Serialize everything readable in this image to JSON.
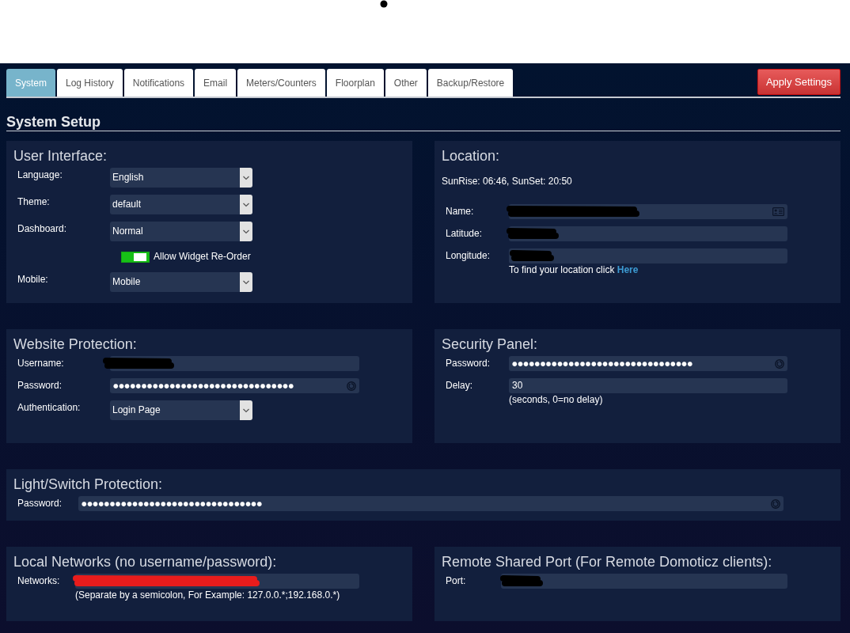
{
  "tabs": [
    {
      "label": "System",
      "selected": true
    },
    {
      "label": "Log History",
      "selected": false
    },
    {
      "label": "Notifications",
      "selected": false
    },
    {
      "label": "Email",
      "selected": false
    },
    {
      "label": "Meters/Counters",
      "selected": false
    },
    {
      "label": "Floorplan",
      "selected": false
    },
    {
      "label": "Other",
      "selected": false
    },
    {
      "label": "Backup/Restore",
      "selected": false
    }
  ],
  "apply_button": "Apply Settings",
  "heading": "System Setup",
  "rows": [
    [
      {
        "title": "User Interface:",
        "items": [
          {
            "kind": "select",
            "label": "Language:",
            "value": "English"
          },
          {
            "kind": "select",
            "label": "Theme:",
            "value": "default"
          },
          {
            "kind": "select",
            "label": "Dashboard:",
            "value": "Normal"
          },
          {
            "kind": "toggle",
            "label": "Allow Widget Re-Order",
            "on": true
          },
          {
            "kind": "select",
            "label": "Mobile:",
            "value": "Mobile"
          }
        ]
      },
      {
        "title": "Location:",
        "items": [
          {
            "kind": "info",
            "text": "SunRise: 06:46, SunSet: 20:50"
          },
          {
            "kind": "input",
            "label": "Name:",
            "autofill": true,
            "redaction": {
              "color": "#000000"
            }
          },
          {
            "kind": "input",
            "label": "Latitude:",
            "redaction": {
              "color": "#000000"
            }
          },
          {
            "kind": "input",
            "label": "Longitude:",
            "redaction": {
              "color": "#000000"
            },
            "note": "To find your location click",
            "note_link": "Here"
          }
        ]
      }
    ],
    [
      {
        "title": "Website Protection:",
        "items": [
          {
            "kind": "input",
            "label": "Username:",
            "redaction": {
              "color": "#000000"
            }
          },
          {
            "kind": "password",
            "label": "Password:",
            "value": "●●●●●●●●●●●●●●●●●●●●●●●●●●●●●●●●"
          },
          {
            "kind": "select",
            "label": "Authentication:",
            "value": "Login Page"
          }
        ]
      },
      {
        "title": "Security Panel:",
        "items": [
          {
            "kind": "password",
            "label": "Password:",
            "value": "●●●●●●●●●●●●●●●●●●●●●●●●●●●●●●●●"
          },
          {
            "kind": "input",
            "label": "Delay:",
            "value": "30",
            "note": "(seconds, 0=no delay)"
          }
        ]
      }
    ],
    [
      {
        "title": "Light/Switch Protection:",
        "items": [
          {
            "kind": "password",
            "label": "Password:",
            "value": "●●●●●●●●●●●●●●●●●●●●●●●●●●●●●●●●"
          }
        ]
      }
    ],
    [
      {
        "title": "Local Networks (no username/password):",
        "items": [
          {
            "kind": "input",
            "label": "Networks:",
            "redaction": {
              "color": "#e81c1c"
            },
            "note": "(Separate by a semicolon, For Example: 127.0.0.*;192.168.0.*)"
          }
        ]
      },
      {
        "title": "Remote Shared Port (For Remote Domoticz clients):",
        "items": [
          {
            "kind": "input",
            "label": "Port:",
            "redaction": {
              "color": "#000000"
            }
          }
        ]
      }
    ]
  ]
}
